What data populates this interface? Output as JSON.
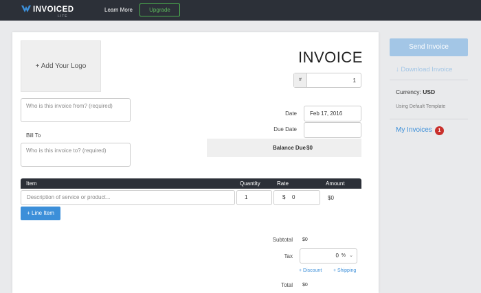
{
  "nav": {
    "logo_text": "INVOICED",
    "logo_sub": "LITE",
    "learn_more": "Learn More",
    "upgrade": "Upgrade"
  },
  "invoice": {
    "logo_placeholder": "+ Add Your Logo",
    "from_placeholder": "Who is this invoice from? (required)",
    "bill_to_label": "Bill To",
    "to_placeholder": "Who is this invoice to? (required)",
    "title": "INVOICE",
    "number_prefix": "#",
    "number": "1",
    "date_label": "Date",
    "date_value": "Feb 17, 2016",
    "due_date_label": "Due Date",
    "due_date_value": "",
    "balance_label": "Balance Due",
    "balance_value": "$0"
  },
  "table": {
    "headers": {
      "item": "Item",
      "quantity": "Quantity",
      "rate": "Rate",
      "amount": "Amount"
    },
    "row": {
      "description_placeholder": "Description of service or product...",
      "quantity": "1",
      "rate_currency": "$",
      "rate": "0",
      "amount": "$0"
    },
    "add_line": "+ Line Item"
  },
  "totals": {
    "subtotal_label": "Subtotal",
    "subtotal_value": "$0",
    "tax_label": "Tax",
    "tax_value": "0",
    "tax_unit": "%",
    "discount_link": "+ Discount",
    "shipping_link": "+ Shipping",
    "total_label": "Total",
    "total_value": "$0"
  },
  "sidebar": {
    "send": "Send Invoice",
    "download": "Download Invoice",
    "download_icon": "↓",
    "currency_label": "Currency:",
    "currency_value": "USD",
    "template": "Using Default Template",
    "my_invoices": "My Invoices",
    "my_invoices_count": "1"
  },
  "colors": {
    "topbar": "#2c3038",
    "accent": "#3c8fd9",
    "upgrade": "#5cb85c",
    "badge": "#c9302c"
  }
}
